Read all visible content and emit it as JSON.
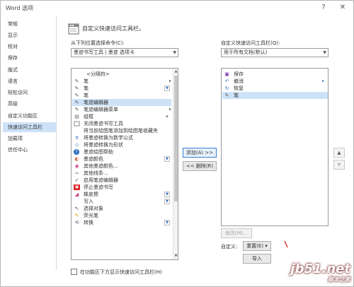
{
  "window": {
    "title": "Word 选项",
    "help_glyph": "?",
    "close_glyph": "✕"
  },
  "sidebar": {
    "items": [
      {
        "label": "常规",
        "selected": false
      },
      {
        "label": "显示",
        "selected": false
      },
      {
        "label": "校对",
        "selected": false
      },
      {
        "label": "保存",
        "selected": false
      },
      {
        "label": "版式",
        "selected": false
      },
      {
        "label": "语言",
        "selected": false
      },
      {
        "label": "轻松访问",
        "selected": false
      },
      {
        "label": "高级",
        "selected": false
      },
      {
        "label": "自定义功能区",
        "selected": false
      },
      {
        "label": "快速访问工具栏",
        "selected": true
      },
      {
        "label": "加载项",
        "selected": false
      },
      {
        "label": "信任中心",
        "selected": false
      }
    ]
  },
  "main": {
    "title": "自定义快速访问工具栏。",
    "left_label": "从下列位置选择命令(C):",
    "left_combo": "墨迹书写工具 | 墨迹 选项卡",
    "right_label": "自定义快速访问工具栏(Q):",
    "right_combo": "用于所有文档(默认)",
    "commands": [
      {
        "label": "<分隔符>",
        "icon": "separator-icon",
        "glyph": "",
        "sub": "",
        "dd": false,
        "selected": false
      },
      {
        "label": "笔",
        "icon": "pen-icon",
        "glyph": "✎",
        "sub": "▸",
        "dd": false,
        "selected": false
      },
      {
        "label": "笔",
        "icon": "pen-icon",
        "glyph": "✎",
        "sub": "",
        "dd": true,
        "selected": false
      },
      {
        "label": "笔",
        "icon": "pen-icon",
        "glyph": "✎",
        "sub": "",
        "dd": false,
        "selected": false
      },
      {
        "label": "笔迹编辑器",
        "icon": "pen-editor-icon",
        "glyph": "✎",
        "sub": "",
        "dd": false,
        "selected": true
      },
      {
        "label": "笔迹编辑器菜单",
        "icon": "pen-editor-menu-icon",
        "glyph": "✎",
        "sub": "▸",
        "dd": false,
        "selected": false
      },
      {
        "label": "组框",
        "icon": "group-icon",
        "glyph": "▤",
        "sub": "",
        "dd": false,
        "selected": false
      },
      {
        "label": "关闭墨迹书写工具",
        "icon": "close-ink-icon",
        "glyph": "",
        "sub": "",
        "dd": false,
        "selected": false
      },
      {
        "label": "将当前绘图笔添加到绘图笔收藏夹",
        "icon": "favorite-pen-icon",
        "glyph": "",
        "sub": "",
        "dd": false,
        "selected": false
      },
      {
        "label": "将墨迹转换为数学公式",
        "icon": "ink-math-icon",
        "glyph": "π",
        "sub": "",
        "dd": false,
        "selected": false
      },
      {
        "label": "将墨迹转换为形状",
        "icon": "ink-shape-icon",
        "glyph": "◇",
        "sub": "",
        "dd": false,
        "selected": false
      },
      {
        "label": "墨迹绘图帮助",
        "icon": "help-icon",
        "glyph": "?",
        "sub": "",
        "dd": false,
        "selected": false
      },
      {
        "label": "墨迹颜色",
        "icon": "ink-color-icon",
        "glyph": "◐",
        "sub": "",
        "dd": true,
        "selected": false
      },
      {
        "label": "其他墨迹颜色...",
        "icon": "palette-icon",
        "glyph": "◉",
        "sub": "",
        "dd": false,
        "selected": false
      },
      {
        "label": "其他线条...",
        "icon": "line-icon",
        "glyph": "═",
        "sub": "",
        "dd": false,
        "selected": false
      },
      {
        "label": "启用笔迹编辑器",
        "icon": "check-icon",
        "glyph": "✓",
        "sub": "",
        "dd": false,
        "selected": false
      },
      {
        "label": "停止墨迹书写",
        "icon": "stop-ink-icon",
        "glyph": "✖",
        "sub": "",
        "dd": false,
        "selected": false
      },
      {
        "label": "橡皮擦",
        "icon": "eraser-icon",
        "glyph": "◢",
        "sub": "",
        "dd": true,
        "selected": false
      },
      {
        "label": "写入",
        "icon": "write-icon",
        "glyph": "",
        "sub": "",
        "dd": true,
        "selected": false
      },
      {
        "label": "选择对象",
        "icon": "select-object-icon",
        "glyph": "↖",
        "sub": "",
        "dd": false,
        "selected": false
      },
      {
        "label": "荧光笔",
        "icon": "highlighter-icon",
        "glyph": "✎",
        "sub": "",
        "dd": false,
        "selected": false
      },
      {
        "label": "转换",
        "icon": "convert-icon",
        "glyph": "⟲",
        "sub": "",
        "dd": true,
        "selected": false
      }
    ],
    "add_button": "添加(A) >>",
    "remove_button": "<< 删除(R)",
    "toolbar_items": [
      {
        "label": "保存",
        "icon": "save-icon",
        "glyph": "▣",
        "sub": "",
        "selected": false
      },
      {
        "label": "撤消",
        "icon": "undo-icon",
        "glyph": "↶",
        "sub": "▸",
        "selected": false
      },
      {
        "label": "恢复",
        "icon": "redo-icon",
        "glyph": "↻",
        "sub": "",
        "selected": false
      },
      {
        "label": "笔",
        "icon": "pen-icon",
        "glyph": "✎",
        "sub": "",
        "selected": true
      }
    ],
    "move_up": "▲",
    "move_down": "▼",
    "modify_button": "修改(M)...",
    "customize_label": "自定义:",
    "reset_button": "重置(E) ▾",
    "import_button": "导入",
    "checkbox_label": "在功能区下方显示快速访问工具栏(H)",
    "checkbox_checked": false
  },
  "watermark": {
    "line1": "jb51.net",
    "line2": "脚本之家"
  },
  "colors": {
    "selection": "#cde2f7",
    "accent": "#3c7fd0"
  }
}
